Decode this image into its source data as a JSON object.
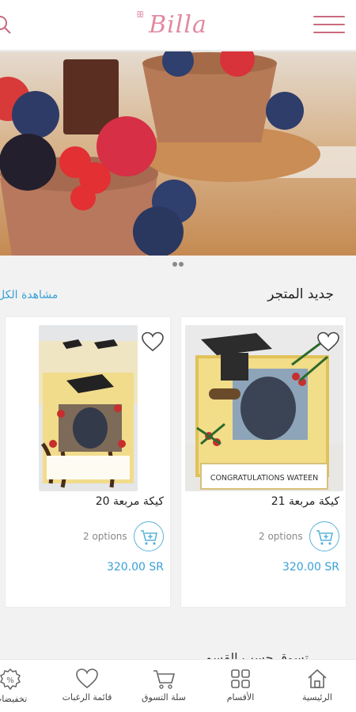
{
  "header": {
    "logo_text": "Billa"
  },
  "section": {
    "title": "جديد المتجر",
    "view_all": "مشاهدة الكل"
  },
  "products": [
    {
      "name": "كيكة مربعة 21",
      "options": "2 options",
      "price": "320.00 SR",
      "cake_text": "CONGRATULATIONS WATEEN"
    },
    {
      "name": "كيكة مربعة 20",
      "options": "2 options",
      "price": "320.00 SR"
    }
  ],
  "next_section": "تسوق حسب القسم",
  "bottom_nav": [
    {
      "label": "الرئيسية",
      "icon": "home-icon"
    },
    {
      "label": "الأقسام",
      "icon": "grid-icon"
    },
    {
      "label": "سلة التسوق",
      "icon": "cart-icon"
    },
    {
      "label": "قائمة الرغبات",
      "icon": "heart-icon"
    },
    {
      "label": "تخفيضات",
      "icon": "sale-badge-icon"
    }
  ],
  "colors": {
    "brand": "#e08aa0",
    "accent": "#3aa0d8"
  }
}
